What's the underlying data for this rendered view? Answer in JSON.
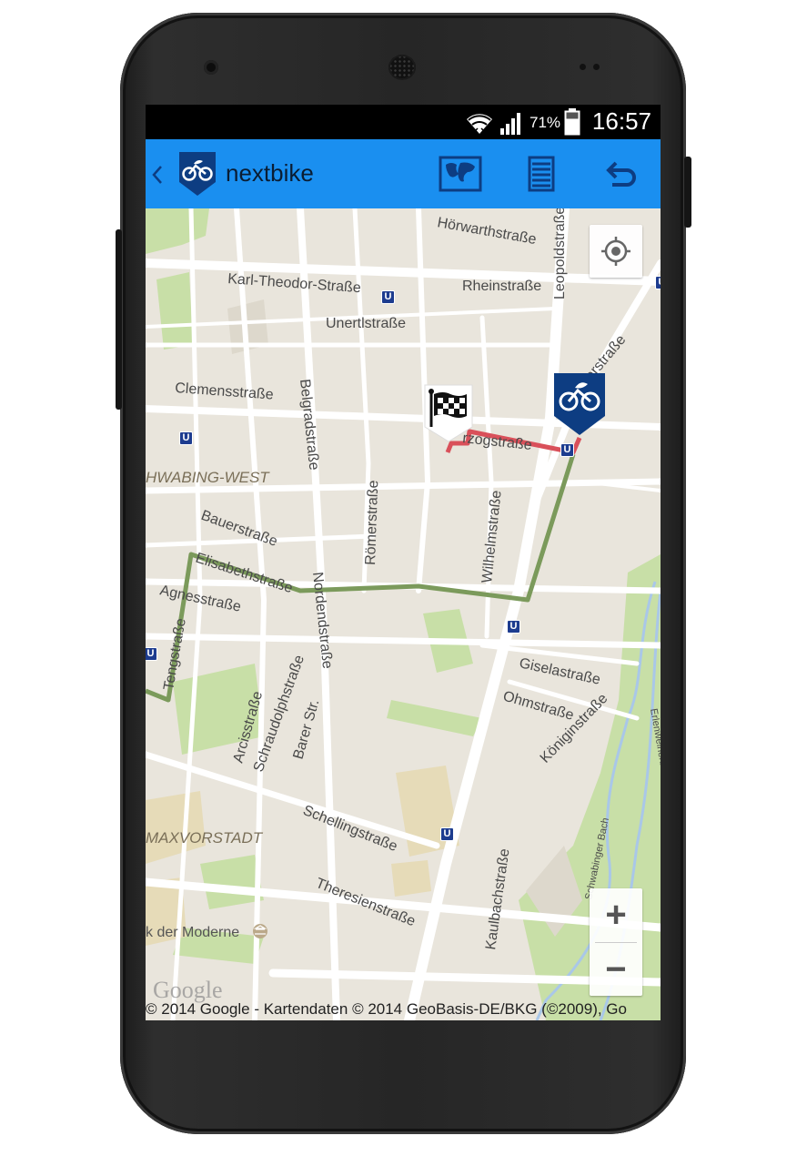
{
  "status_bar": {
    "battery_percent": "71%",
    "time": "16:57",
    "icons": [
      "wifi-icon",
      "signal-icon",
      "battery-icon"
    ]
  },
  "action_bar": {
    "back_icon": "chevron-left-icon",
    "app_title": "nextbike",
    "actions": [
      "map-icon",
      "list-icon",
      "undo-icon"
    ],
    "color": "#1a8ff0"
  },
  "map": {
    "streets": [
      "Hörwarthstraße",
      "Karl-Theodor-Straße",
      "Rheinstraße",
      "Leopoldstraße",
      "Unertlstraße",
      "Clemensstraße",
      "Belgradstraße",
      "Herzogstraße",
      "Bauerstraße",
      "Römerstraße",
      "Wilhelmstraße",
      "Elisabethstraße",
      "Agnesstraße",
      "Nordendstraße",
      "Tengstraße",
      "Giselastraße",
      "Ohmstraße",
      "Königinstraße",
      "Arcisstraße",
      "Schraudolphstraße",
      "Barer Str.",
      "Schellingstraße",
      "Theresienstraße",
      "Kaulbachstraße",
      "Schwabinger Bach",
      "Erlenweiherbach"
    ],
    "herzog_partial": "rzogstraße",
    "werneck_partial": "erstraße",
    "districts": [
      "HWABING-WEST",
      "MAXVORSTADT"
    ],
    "poi": "k der Moderne",
    "subway_marker": "U",
    "route_color": "#7b9a5b",
    "walk_color": "#d9505a",
    "marker_color": "#0d3d82",
    "zoom_in": "+",
    "zoom_out": "−",
    "google_logo": "Google",
    "attribution": "© 2014 Google - Kartendaten © 2014 GeoBasis-DE/BKG (©2009), Go"
  }
}
